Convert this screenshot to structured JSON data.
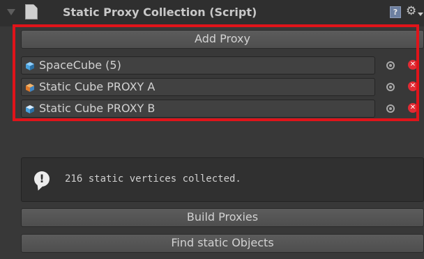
{
  "component": {
    "title": "Static Proxy Collection (Script)",
    "help_icon": "help-icon",
    "settings_icon": "gear-icon"
  },
  "buttons": {
    "add_proxy": "Add Proxy",
    "build_proxies": "Build Proxies",
    "find_static_objects": "Find static Objects"
  },
  "proxies": [
    {
      "label": "SpaceCube (5)",
      "icon": "cube-icon",
      "icon_color": "#4aa3df"
    },
    {
      "label": "Static Cube PROXY A",
      "icon": "cube-icon",
      "icon_color": "#e07a2a"
    },
    {
      "label": "Static Cube PROXY B",
      "icon": "cube-icon",
      "icon_color": "#4aa3df"
    }
  ],
  "info": {
    "message": "216 static vertices collected.",
    "icon": "info-icon"
  },
  "colors": {
    "highlight": "#e0141a",
    "remove": "#e22b34"
  }
}
